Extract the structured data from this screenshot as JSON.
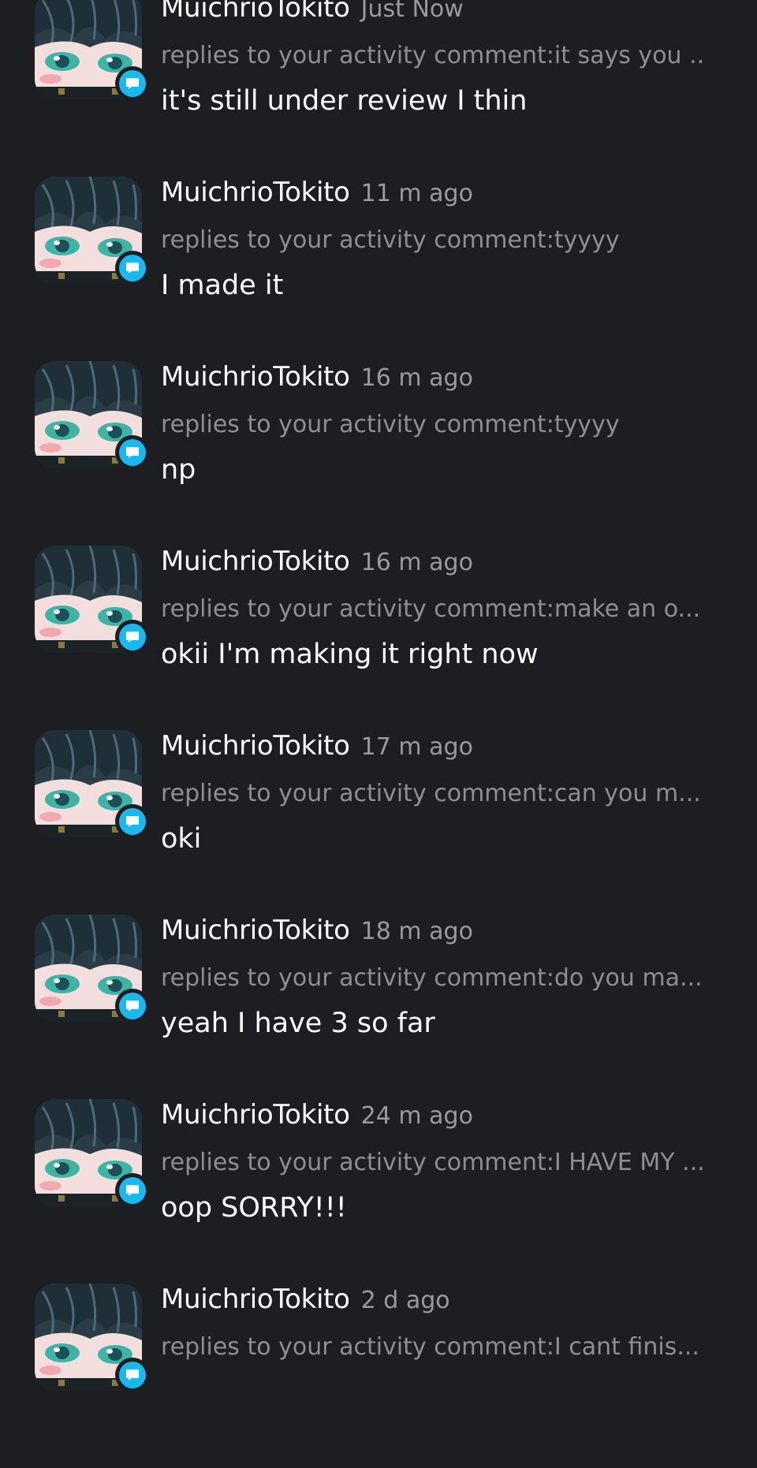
{
  "colors": {
    "background": "#1d1e21",
    "badge": "#1ab8ee",
    "secondary_text": "#8e8e93"
  },
  "notifications": [
    {
      "username": "MuichrioTokito",
      "time": "Just Now",
      "context": "replies to your activity comment:it says you ...",
      "message": "it's still under review I thin",
      "badge_icon": "chat-bubble-icon"
    },
    {
      "username": "MuichrioTokito",
      "time": "11 m ago",
      "context": "replies to your activity comment:tyyyy",
      "message": "I made it",
      "badge_icon": "chat-bubble-icon"
    },
    {
      "username": "MuichrioTokito",
      "time": "16 m ago",
      "context": "replies to your activity comment:tyyyy",
      "message": "np",
      "badge_icon": "chat-bubble-icon"
    },
    {
      "username": "MuichrioTokito",
      "time": "16 m ago",
      "context": "replies to your activity comment:make an o...",
      "message": "okii I'm making it right now",
      "badge_icon": "chat-bubble-icon"
    },
    {
      "username": "MuichrioTokito",
      "time": "17 m ago",
      "context": "replies to your activity comment:can you m...",
      "message": "oki",
      "badge_icon": "chat-bubble-icon"
    },
    {
      "username": "MuichrioTokito",
      "time": "18 m ago",
      "context": "replies to your activity comment:do you ma...",
      "message": "yeah I have 3 so far",
      "badge_icon": "chat-bubble-icon"
    },
    {
      "username": "MuichrioTokito",
      "time": "24 m ago",
      "context": "replies to your activity comment:I HAVE MY ...",
      "message": "oop SORRY!!!",
      "badge_icon": "chat-bubble-icon"
    },
    {
      "username": "MuichrioTokito",
      "time": "2 d ago",
      "context": "replies to your activity comment:I cant finis...",
      "message": "",
      "badge_icon": "chat-bubble-icon"
    }
  ]
}
